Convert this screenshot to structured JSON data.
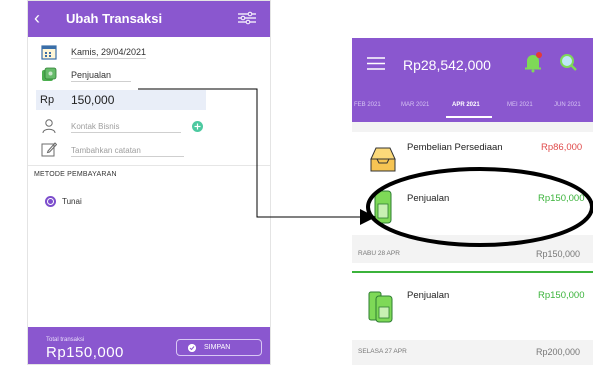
{
  "left": {
    "title": "Ubah Transaksi",
    "date": "Kamis, 29/04/2021",
    "category": "Penjualan",
    "currency": "Rp",
    "amount": "150,000",
    "contact_placeholder": "Kontak Bisnis",
    "note_placeholder": "Tambahkan catatan",
    "payment_section": "METODE PEMBAYARAN",
    "payment_option": "Tunai",
    "total_label": "Total transaksi",
    "total_value": "Rp150,000",
    "save_label": "SIMPAN"
  },
  "right": {
    "balance": "Rp28,542,000",
    "months": [
      "FEB 2021",
      "MAR 2021",
      "APR 2021",
      "MEI 2021",
      "JUN 2021"
    ],
    "active_month": "APR 2021",
    "transactions": [
      {
        "title": "Pembelian Persediaan",
        "amount": "Rp86,000",
        "type": "expense"
      },
      {
        "title": "Penjualan",
        "amount": "Rp150,000",
        "type": "income"
      }
    ],
    "day1": {
      "label": "RABU 28 APR",
      "total": "Rp150,000"
    },
    "day1_transactions": [
      {
        "title": "Penjualan",
        "amount": "Rp150,000",
        "type": "income"
      }
    ],
    "day2": {
      "label": "SELASA 27 APR",
      "total": "Rp200,000"
    }
  },
  "colors": {
    "primary": "#8a57cf",
    "income": "#3bb33b",
    "expense": "#e04b4b"
  },
  "icons": [
    "back-icon",
    "filter-icon",
    "calendar-icon",
    "money-icon",
    "person-icon",
    "note-icon",
    "check-icon",
    "menu-icon",
    "bell-icon",
    "search-icon",
    "inbox-icon",
    "pos-icon",
    "arrow-icon"
  ]
}
